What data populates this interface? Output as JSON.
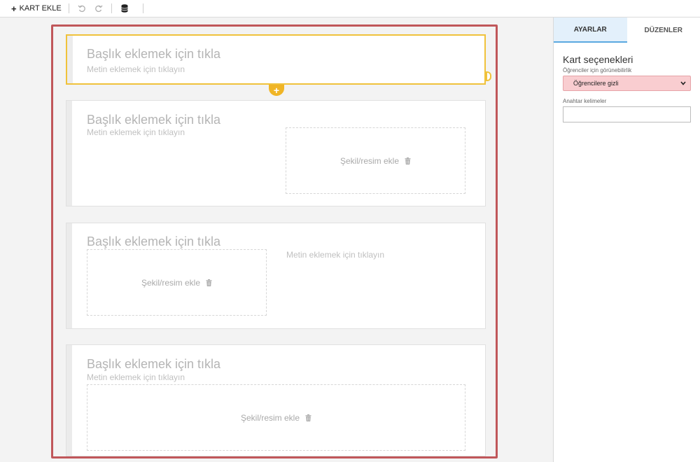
{
  "toolbar": {
    "add_card_label": "KART EKLE",
    "icons": [
      "undo-icon",
      "redo-icon",
      "database-icon"
    ]
  },
  "cards": [
    {
      "title": "Başlık eklemek için tıkla",
      "text": "Metin eklemek için tıklayın"
    },
    {
      "title": "Başlık eklemek için tıkla",
      "text": "Metin eklemek için tıklayın",
      "image_label": "Şekil/resim ekle"
    },
    {
      "title": "Başlık eklemek için tıkla",
      "text": "Metin eklemek için tıklayın",
      "image_label": "Şekil/resim ekle"
    },
    {
      "title": "Başlık eklemek için tıkla",
      "text": "Metin eklemek için tıklayın",
      "image_label": "Şekil/resim ekle"
    }
  ],
  "panel": {
    "tabs": [
      {
        "label": "AYARLAR",
        "active": true
      },
      {
        "label": "DÜZENLER",
        "active": false
      }
    ],
    "section_title": "Kart seçenekleri",
    "visibility_label": "Öğrenciler için görünebilirlik",
    "visibility_value": "Öğrencilere gizli",
    "keywords_label": "Anahtar kelimeler",
    "keywords_value": ""
  },
  "colors": {
    "frame": "#c0575a",
    "selected": "#f0c23b",
    "accent": "#f0b526",
    "visibility_bg": "#f9cdd0",
    "active_tab": "#e3f0fb"
  }
}
